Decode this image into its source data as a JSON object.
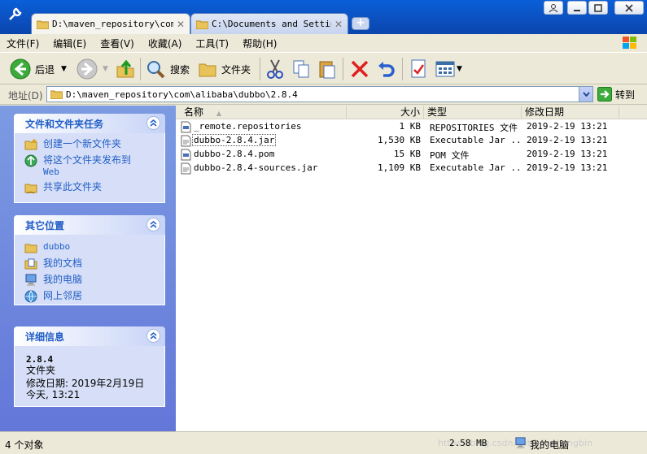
{
  "window": {
    "tabs": [
      {
        "label": "D:\\maven_repository\\com\\",
        "active": true
      },
      {
        "label": "C:\\Documents and Setting",
        "active": false
      }
    ],
    "new_tab": "+"
  },
  "menubar": {
    "items": [
      "文件(F)",
      "编辑(E)",
      "查看(V)",
      "收藏(A)",
      "工具(T)",
      "帮助(H)"
    ]
  },
  "toolbar": {
    "back_label": "后退",
    "search_label": "搜索",
    "folders_label": "文件夹"
  },
  "address": {
    "label": "地址(D)",
    "value": "D:\\maven_repository\\com\\alibaba\\dubbo\\2.8.4",
    "go_label": "转到"
  },
  "left_pane": {
    "tasks": {
      "title": "文件和文件夹任务",
      "items": [
        "创建一个新文件夹",
        "将这个文件夹发布到",
        "共享此文件夹"
      ],
      "web_suffix": "Web"
    },
    "places": {
      "title": "其它位置",
      "items": [
        "dubbo",
        "我的文档",
        "我的电脑",
        "网上邻居"
      ]
    },
    "details": {
      "title": "详细信息",
      "name": "2.8.4",
      "type": "文件夹",
      "modified": "修改日期: 2019年2月19日",
      "today": "今天, 13:21"
    }
  },
  "file_list": {
    "columns": {
      "name": "名称",
      "size": "大小",
      "type": "类型",
      "modified": "修改日期"
    },
    "rows": [
      {
        "name": "_remote.repositories",
        "size": "1 KB",
        "type": "REPOSITORIES 文件",
        "modified": "2019-2-19 13:21"
      },
      {
        "name": "dubbo-2.8.4.jar",
        "size": "1,530 KB",
        "type": "Executable Jar ...",
        "modified": "2019-2-19 13:21"
      },
      {
        "name": "dubbo-2.8.4.pom",
        "size": "15 KB",
        "type": "POM 文件",
        "modified": "2019-2-19 13:21"
      },
      {
        "name": "dubbo-2.8.4-sources.jar",
        "size": "1,109 KB",
        "type": "Executable Jar ...",
        "modified": "2019-2-19 13:21"
      }
    ]
  },
  "status": {
    "count": "4 个对象",
    "size": "2.58 MB",
    "location": "我的电脑",
    "watermark": "https://blog.csdn.net/hanghongbin"
  },
  "colors": {
    "titlebar": "#0b4fbe",
    "task_link": "#215dc6",
    "pane": "#6f8ae0"
  }
}
